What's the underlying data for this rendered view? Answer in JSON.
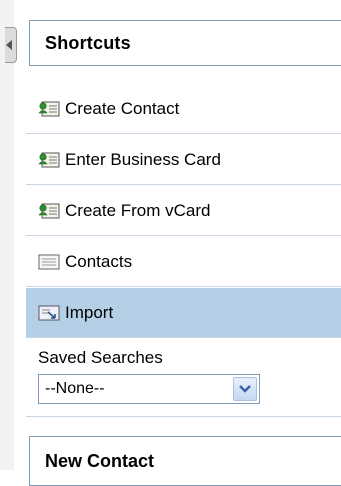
{
  "sidebar": {
    "title": "Shortcuts",
    "items": [
      {
        "label": "Create Contact",
        "icon": "contact-card-add-icon"
      },
      {
        "label": "Enter Business Card",
        "icon": "contact-card-add-icon"
      },
      {
        "label": "Create From vCard",
        "icon": "contact-card-add-icon"
      },
      {
        "label": "Contacts",
        "icon": "contacts-list-icon"
      },
      {
        "label": "Import",
        "icon": "import-icon",
        "selected": true
      }
    ],
    "saved_searches": {
      "label": "Saved Searches",
      "selected": "--None--"
    },
    "next_section_title": "New Contact"
  },
  "colors": {
    "selected_bg": "#b5cfe6",
    "border": "#7f9db9",
    "separator": "#c9d7e4"
  }
}
